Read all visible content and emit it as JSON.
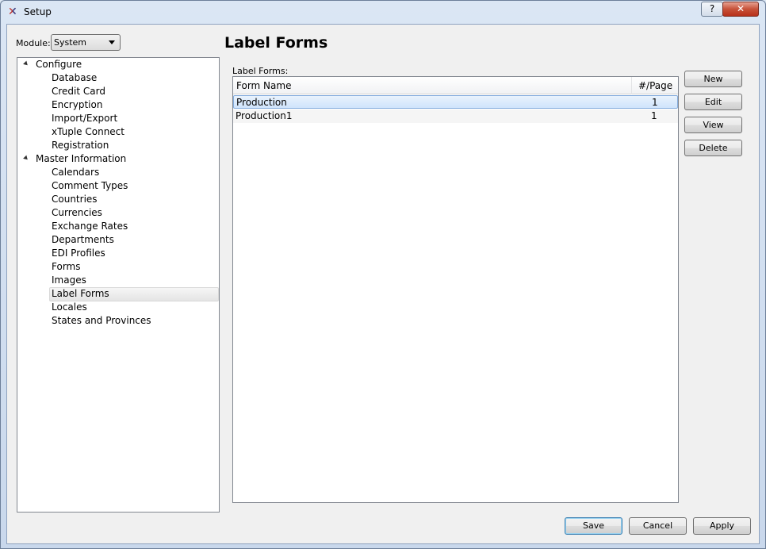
{
  "window": {
    "title": "Setup",
    "help_label": "?",
    "close_label": "✕"
  },
  "module": {
    "label": "Module:",
    "value": "System"
  },
  "tree": {
    "groups": [
      {
        "label": "Configure",
        "items": [
          "Database",
          "Credit Card",
          "Encryption",
          "Import/Export",
          "xTuple Connect",
          "Registration"
        ]
      },
      {
        "label": "Master Information",
        "items": [
          "Calendars",
          "Comment Types",
          "Countries",
          "Currencies",
          "Exchange Rates",
          "Departments",
          "EDI Profiles",
          "Forms",
          "Images",
          "Label Forms",
          "Locales",
          "States and Provinces"
        ]
      }
    ],
    "selected": "Label Forms"
  },
  "main": {
    "title": "Label Forms",
    "list_label": "Label Forms:",
    "columns": [
      "Form Name",
      "#/Page"
    ],
    "rows": [
      {
        "name": "Production",
        "per_page": "1"
      },
      {
        "name": "Production1",
        "per_page": "1"
      }
    ],
    "selected_row": 0
  },
  "side_buttons": {
    "new": "New",
    "edit": "Edit",
    "view": "View",
    "delete": "Delete"
  },
  "bottom_buttons": {
    "save": "Save",
    "cancel": "Cancel",
    "apply": "Apply"
  }
}
